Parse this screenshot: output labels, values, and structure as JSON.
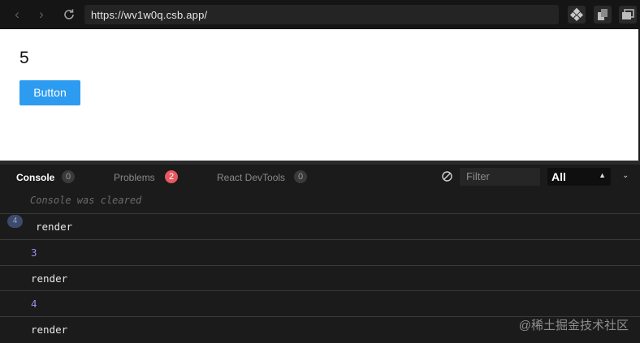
{
  "browser": {
    "url": "https://wv1w0q.csb.app/"
  },
  "page": {
    "count": "5",
    "button_label": "Button"
  },
  "console": {
    "tabs": [
      {
        "label": "Console",
        "badge": "0"
      },
      {
        "label": "Problems",
        "badge": "2"
      },
      {
        "label": "React DevTools",
        "badge": "0"
      }
    ],
    "filter_placeholder": "Filter",
    "level": "All",
    "cleared_message": "Console was cleared",
    "repeat_count": "4",
    "logs": [
      "render",
      "3",
      "render",
      "4",
      "render"
    ]
  },
  "watermark": "@稀土掘金技术社区",
  "colors": {
    "button": "#2d9bf0",
    "problems_badge": "#e7595f",
    "number_log": "#9f8cf0"
  }
}
